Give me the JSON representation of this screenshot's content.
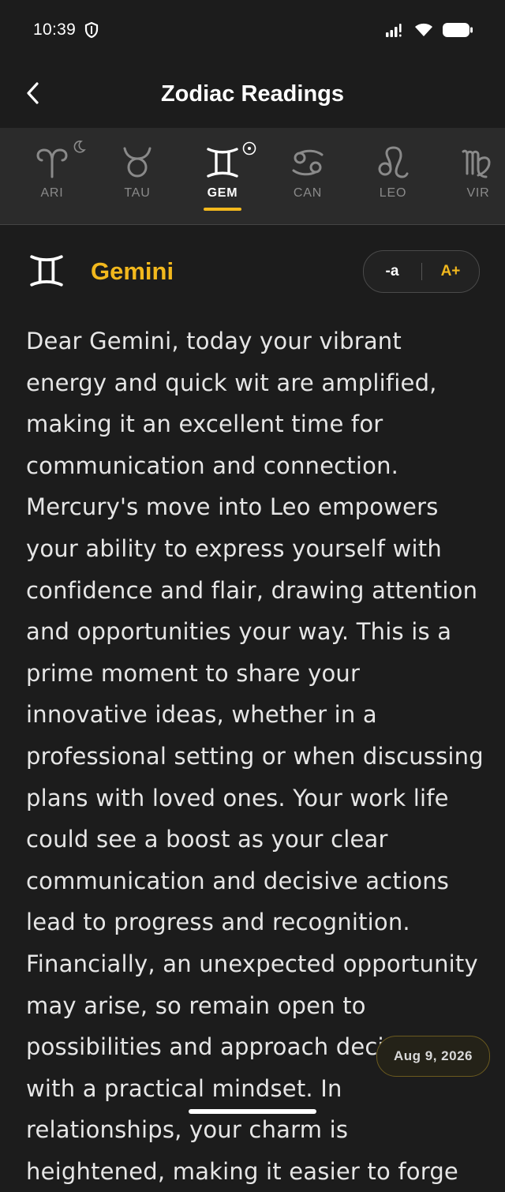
{
  "status_bar": {
    "time": "10:39",
    "icons": [
      "shield-icon",
      "signal-icon",
      "wifi-icon",
      "battery-icon"
    ]
  },
  "app_bar": {
    "title": "Zodiac Readings",
    "back_icon": "chevron-left-icon"
  },
  "sign_tabs": [
    {
      "abbr": "ARI",
      "glyph": "aries-icon",
      "active": false,
      "marker": "moon-icon"
    },
    {
      "abbr": "TAU",
      "glyph": "taurus-icon",
      "active": false
    },
    {
      "abbr": "GEM",
      "glyph": "gemini-icon",
      "active": true,
      "marker": "sun-icon"
    },
    {
      "abbr": "CAN",
      "glyph": "cancer-icon",
      "active": false
    },
    {
      "abbr": "LEO",
      "glyph": "leo-icon",
      "active": false
    },
    {
      "abbr": "VIR",
      "glyph": "virgo-icon",
      "active": false
    }
  ],
  "sign": {
    "name": "Gemini",
    "glyph": "gemini-icon"
  },
  "font_controls": {
    "decrease_label": "-a",
    "increase_label": "A+"
  },
  "reading": {
    "text": "Dear Gemini, today your vibrant energy and quick wit are amplified, making it an excellent time for communication and connection. Mercury's move into Leo empowers your ability to express yourself with confidence and flair, drawing attention and opportunities your way. This is a prime moment to share your innovative ideas, whether in a professional setting or when discussing plans with loved ones. Your work life could see a boost as your clear communication and decisive actions lead to progress and recognition. Financially, an unexpected opportunity may arise, so remain open to possibilities and approach decisions with a practical mindset. In relationships, your charm is heightened, making it easier to forge"
  },
  "date_chip": "Aug 9, 2026",
  "colors": {
    "accent": "#f2b81d",
    "background": "#1c1c1c",
    "tab_bar": "#2b2b2b",
    "muted": "#8a8a8a"
  }
}
